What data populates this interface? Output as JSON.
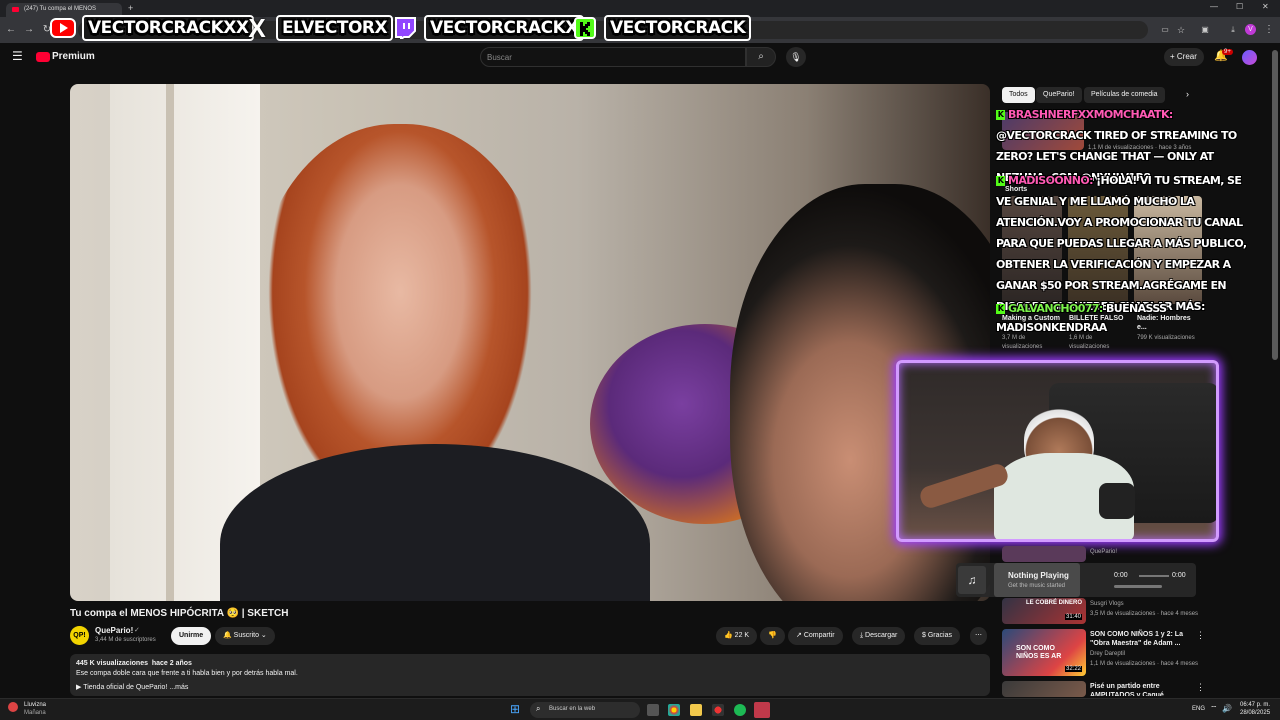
{
  "browser": {
    "tab_title": "(247) Tu compa el MENOS",
    "tab_new": "+"
  },
  "overlay": {
    "socials": [
      {
        "name": "VECTORCRACKXX",
        "icon": "youtube-icon",
        "color": "#ff0000"
      },
      {
        "name": "ELVECTORX",
        "icon": "x-icon",
        "color": "#ffffff"
      },
      {
        "name": "VECTORCRACKX",
        "icon": "twitch-icon",
        "color": "#9146ff"
      },
      {
        "name": "VECTORCRACK",
        "icon": "kick-icon",
        "color": "#53fc18"
      }
    ]
  },
  "header": {
    "brand": "Premium",
    "search_placeholder": "Buscar",
    "create_label": "Crear",
    "notif_count": "9+"
  },
  "video": {
    "title": "Tu compa el MENOS HIPÓCRITA 🥺 | SKETCH",
    "channel": "QuePario!",
    "subscribers": "3,44 M de suscriptores",
    "join_label": "Unirme",
    "subscribed_label": "Suscrito",
    "likes": "22 K",
    "share_label": "Compartir",
    "download_label": "Descargar",
    "thanks_label": "Gracias",
    "views": "445 K visualizaciones",
    "age": "hace 2 años",
    "description": "Ese compa doble cara que frente a ti habla bien y por detrás habla mal.",
    "store_label": "▶ Tienda oficial de QuePario!",
    "more_label": "...más"
  },
  "chips": [
    "Todos",
    "QuePario!",
    "Películas de comedia"
  ],
  "chat": [
    {
      "user": "BRASHNERFXXMOMCHAATK:",
      "user_color": "pink",
      "text": "@VECTORCRACK TIRED OF STREAMING TO ZERO? LET'S CHANGE THAT — ONLY AT NEZHNA .COM @NYHLV1R8"
    },
    {
      "user": "MADISOONNO:",
      "user_color": "pink",
      "text": "¡HOLA! VI TU STREAM, SE VE GENIAL Y ME LLAMÓ MUCHO LA ATENCIÓN.VOY A PROMOCIONAR TU CANAL PARA QUE PUEDAS LLEGAR A MÁS PUBLICO, OBTENER LA VERIFICACIÓN Y EMPEZAR A GANAR $50 POR STREAM.AGRÉGAME EN DISCORD SI QUIERES CHARLAR MÁS: MADISONKENDRAA"
    },
    {
      "user": "GALVANCHO077:",
      "user_color": "green",
      "text": "BUENASSS"
    }
  ],
  "related_top": {
    "meta1": "1,1 M de visualizaciones · hace 3 años",
    "shorts_label": "Shorts",
    "shorts": [
      {
        "title": "Making a Custom XL ...",
        "views": "3,7 M de visualizaciones"
      },
      {
        "title": "BILLETE FALSO 💵",
        "views": "1,6 M de visualizaciones"
      },
      {
        "title": "Nadie: Hombres e...",
        "views": "799 K visualizaciones"
      }
    ]
  },
  "related": [
    {
      "channel": "QuePario!",
      "meta": "",
      "thumb_text": "",
      "duration": ""
    },
    {
      "title": "",
      "channel": "Susgri Vlogs",
      "meta": "3,5 M de visualizaciones · hace 4 meses",
      "thumb_text": "LE COBRÉ DINERO",
      "duration": "31:40"
    },
    {
      "title": "SON COMO NIÑOS 1 y 2: La \"Obra Maestra\" de Adam ...",
      "channel": "Drey Dareptil",
      "meta": "1,1 M de visualizaciones · hace 4 meses",
      "thumb_text": "SON COMO NIÑOS ES AR",
      "duration": "32:22"
    },
    {
      "title": "Pisé un partido entre AMPUTADOS y Cagué REQUEÑ",
      "channel": "",
      "meta": "",
      "thumb_text": "",
      "duration": ""
    }
  ],
  "music": {
    "title": "Nothing Playing",
    "subtitle": "Get the music started",
    "time_start": "0:00",
    "time_end": "0:00"
  },
  "taskbar": {
    "weather": "Lluvizna",
    "weather_sub": "Mañana",
    "search_placeholder": "Buscar en la web",
    "lang": "ENG",
    "time": "06:47 p. m.",
    "date": "28/08/2025"
  },
  "colors": {
    "accent": "#ff0033",
    "glow": "#9b3cff",
    "kick": "#53fc18"
  }
}
